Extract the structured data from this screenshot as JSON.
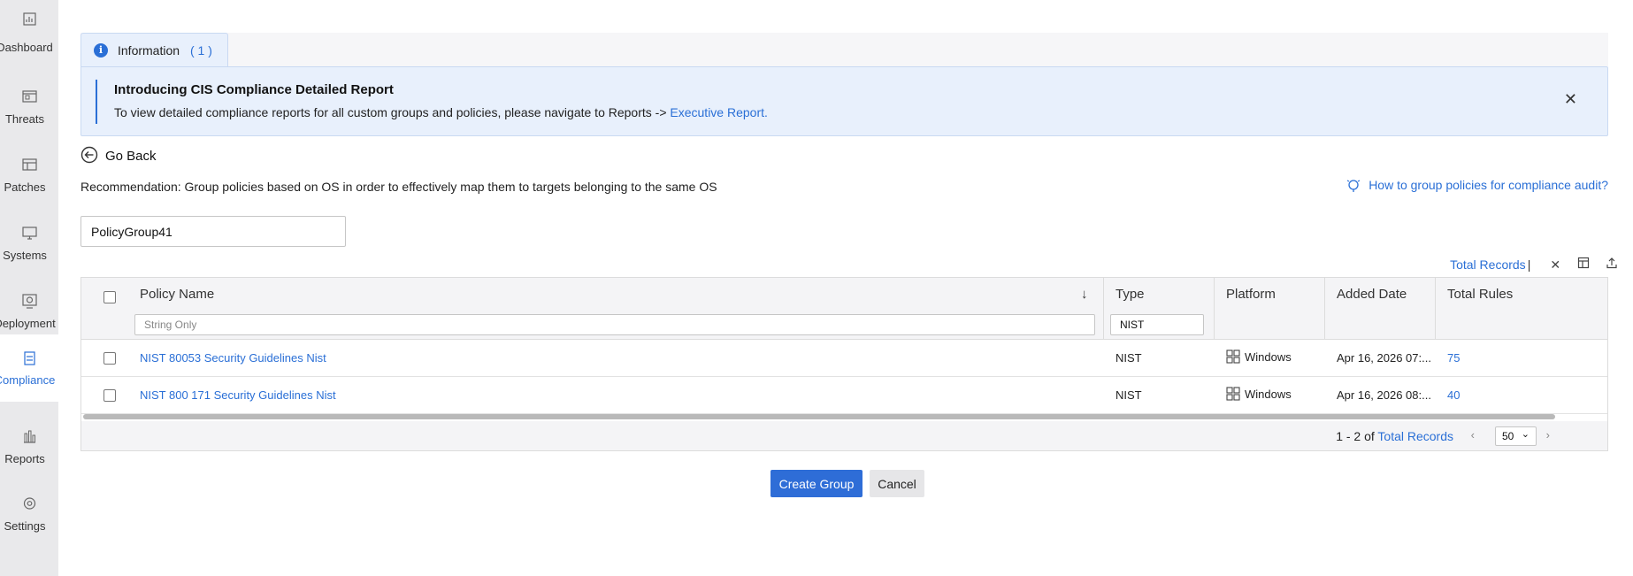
{
  "sidebar": {
    "items": [
      {
        "label": "Dashboard",
        "icon": "dashboard-icon"
      },
      {
        "label": "Threats",
        "icon": "threats-icon"
      },
      {
        "label": "Patches",
        "icon": "patches-icon"
      },
      {
        "label": "Systems",
        "icon": "systems-icon"
      },
      {
        "label": "Deployment",
        "icon": "deployment-icon"
      },
      {
        "label": "Compliance",
        "icon": "compliance-icon",
        "active": true
      },
      {
        "label": "Reports",
        "icon": "reports-icon"
      },
      {
        "label": "Settings",
        "icon": "settings-icon"
      }
    ]
  },
  "info": {
    "tab_label": "Information",
    "tab_count": "( 1 )",
    "title": "Introducing CIS Compliance Detailed Report",
    "text": "To view detailed compliance reports for all custom groups and policies, please navigate to Reports -> ",
    "link": "Executive Report."
  },
  "go_back": "Go Back",
  "recommendation": "Recommendation: Group policies based on OS in order to effectively map them to targets belonging to the same OS",
  "howto_link": "How to group policies for compliance audit?",
  "group_name_value": "PolicyGroup41",
  "toolbar": {
    "total_records": "Total Records",
    "separator": "|"
  },
  "table": {
    "columns": {
      "policy_name": "Policy Name",
      "type": "Type",
      "platform": "Platform",
      "added_date": "Added Date",
      "total_rules": "Total Rules"
    },
    "filters": {
      "policy_name_placeholder": "String Only",
      "type_value": "NIST"
    },
    "rows": [
      {
        "policy_name": "NIST 80053 Security Guidelines Nist",
        "type": "NIST",
        "platform": "Windows",
        "added_date": "Apr 16, 2026 07:...",
        "total_rules": "75"
      },
      {
        "policy_name": "NIST 800 171 Security Guidelines Nist",
        "type": "NIST",
        "platform": "Windows",
        "added_date": "Apr 16, 2026 08:...",
        "total_rules": "40"
      }
    ],
    "footer": {
      "range": "1 - 2 of ",
      "total_records": "Total Records",
      "page_size": "50"
    }
  },
  "buttons": {
    "create": "Create Group",
    "cancel": "Cancel"
  },
  "colors": {
    "accent": "#2e6dd7",
    "link": "#2a6fd6",
    "banner_bg": "#e8f0fc",
    "sidebar_bg": "#e9e9eb"
  }
}
